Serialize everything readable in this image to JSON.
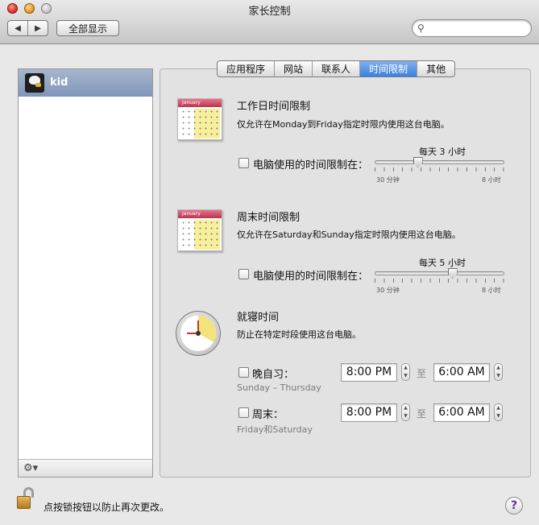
{
  "window": {
    "title": "家长控制"
  },
  "toolbar": {
    "back_icon": "◀",
    "forward_icon": "▶",
    "show_all_label": "全部显示",
    "search_icon": "⚲",
    "search_value": ""
  },
  "users": [
    {
      "name": "kid",
      "selected": true
    }
  ],
  "list_footer": {
    "action_icon": "⚙▾"
  },
  "tabs": [
    {
      "label": "应用程序",
      "active": false
    },
    {
      "label": "网站",
      "active": false
    },
    {
      "label": "联系人",
      "active": false
    },
    {
      "label": "时间限制",
      "active": true
    },
    {
      "label": "其他",
      "active": false
    }
  ],
  "weekday": {
    "title": "工作日时间限制",
    "description": "仅允许在Monday到Friday指定时限内使用这台电脑。",
    "calendar_month": "January",
    "checkbox_label": "电脑使用的时间限制在：",
    "checked": false,
    "slider_value_label": "每天 3 小时",
    "slider_min_label": "30 分钟",
    "slider_max_label": "8 小时",
    "slider_hours": 3
  },
  "weekend": {
    "title": "周末时间限制",
    "description": "仅允许在Saturday和Sunday指定时限内使用这台电脑。",
    "calendar_month": "January",
    "checkbox_label": "电脑使用的时间限制在：",
    "checked": false,
    "slider_value_label": "每天 5 小时",
    "slider_min_label": "30 分钟",
    "slider_max_label": "8 小时",
    "slider_hours": 5
  },
  "bedtime": {
    "title": "就寝时间",
    "description": "防止在特定时段使用这台电脑。",
    "school_nights": {
      "label": "晚自习：",
      "days": "Sunday – Thursday",
      "checked": false,
      "from": "8:00 PM",
      "to_label": "至",
      "to": "6:00 AM"
    },
    "weekend": {
      "label": "周末：",
      "days": "Friday和Saturday",
      "checked": false,
      "from": "8:00 PM",
      "to_label": "至",
      "to": "6:00 AM"
    }
  },
  "footer": {
    "lock_text": "点按锁按钮以防止再次更改。",
    "help_label": "?"
  }
}
